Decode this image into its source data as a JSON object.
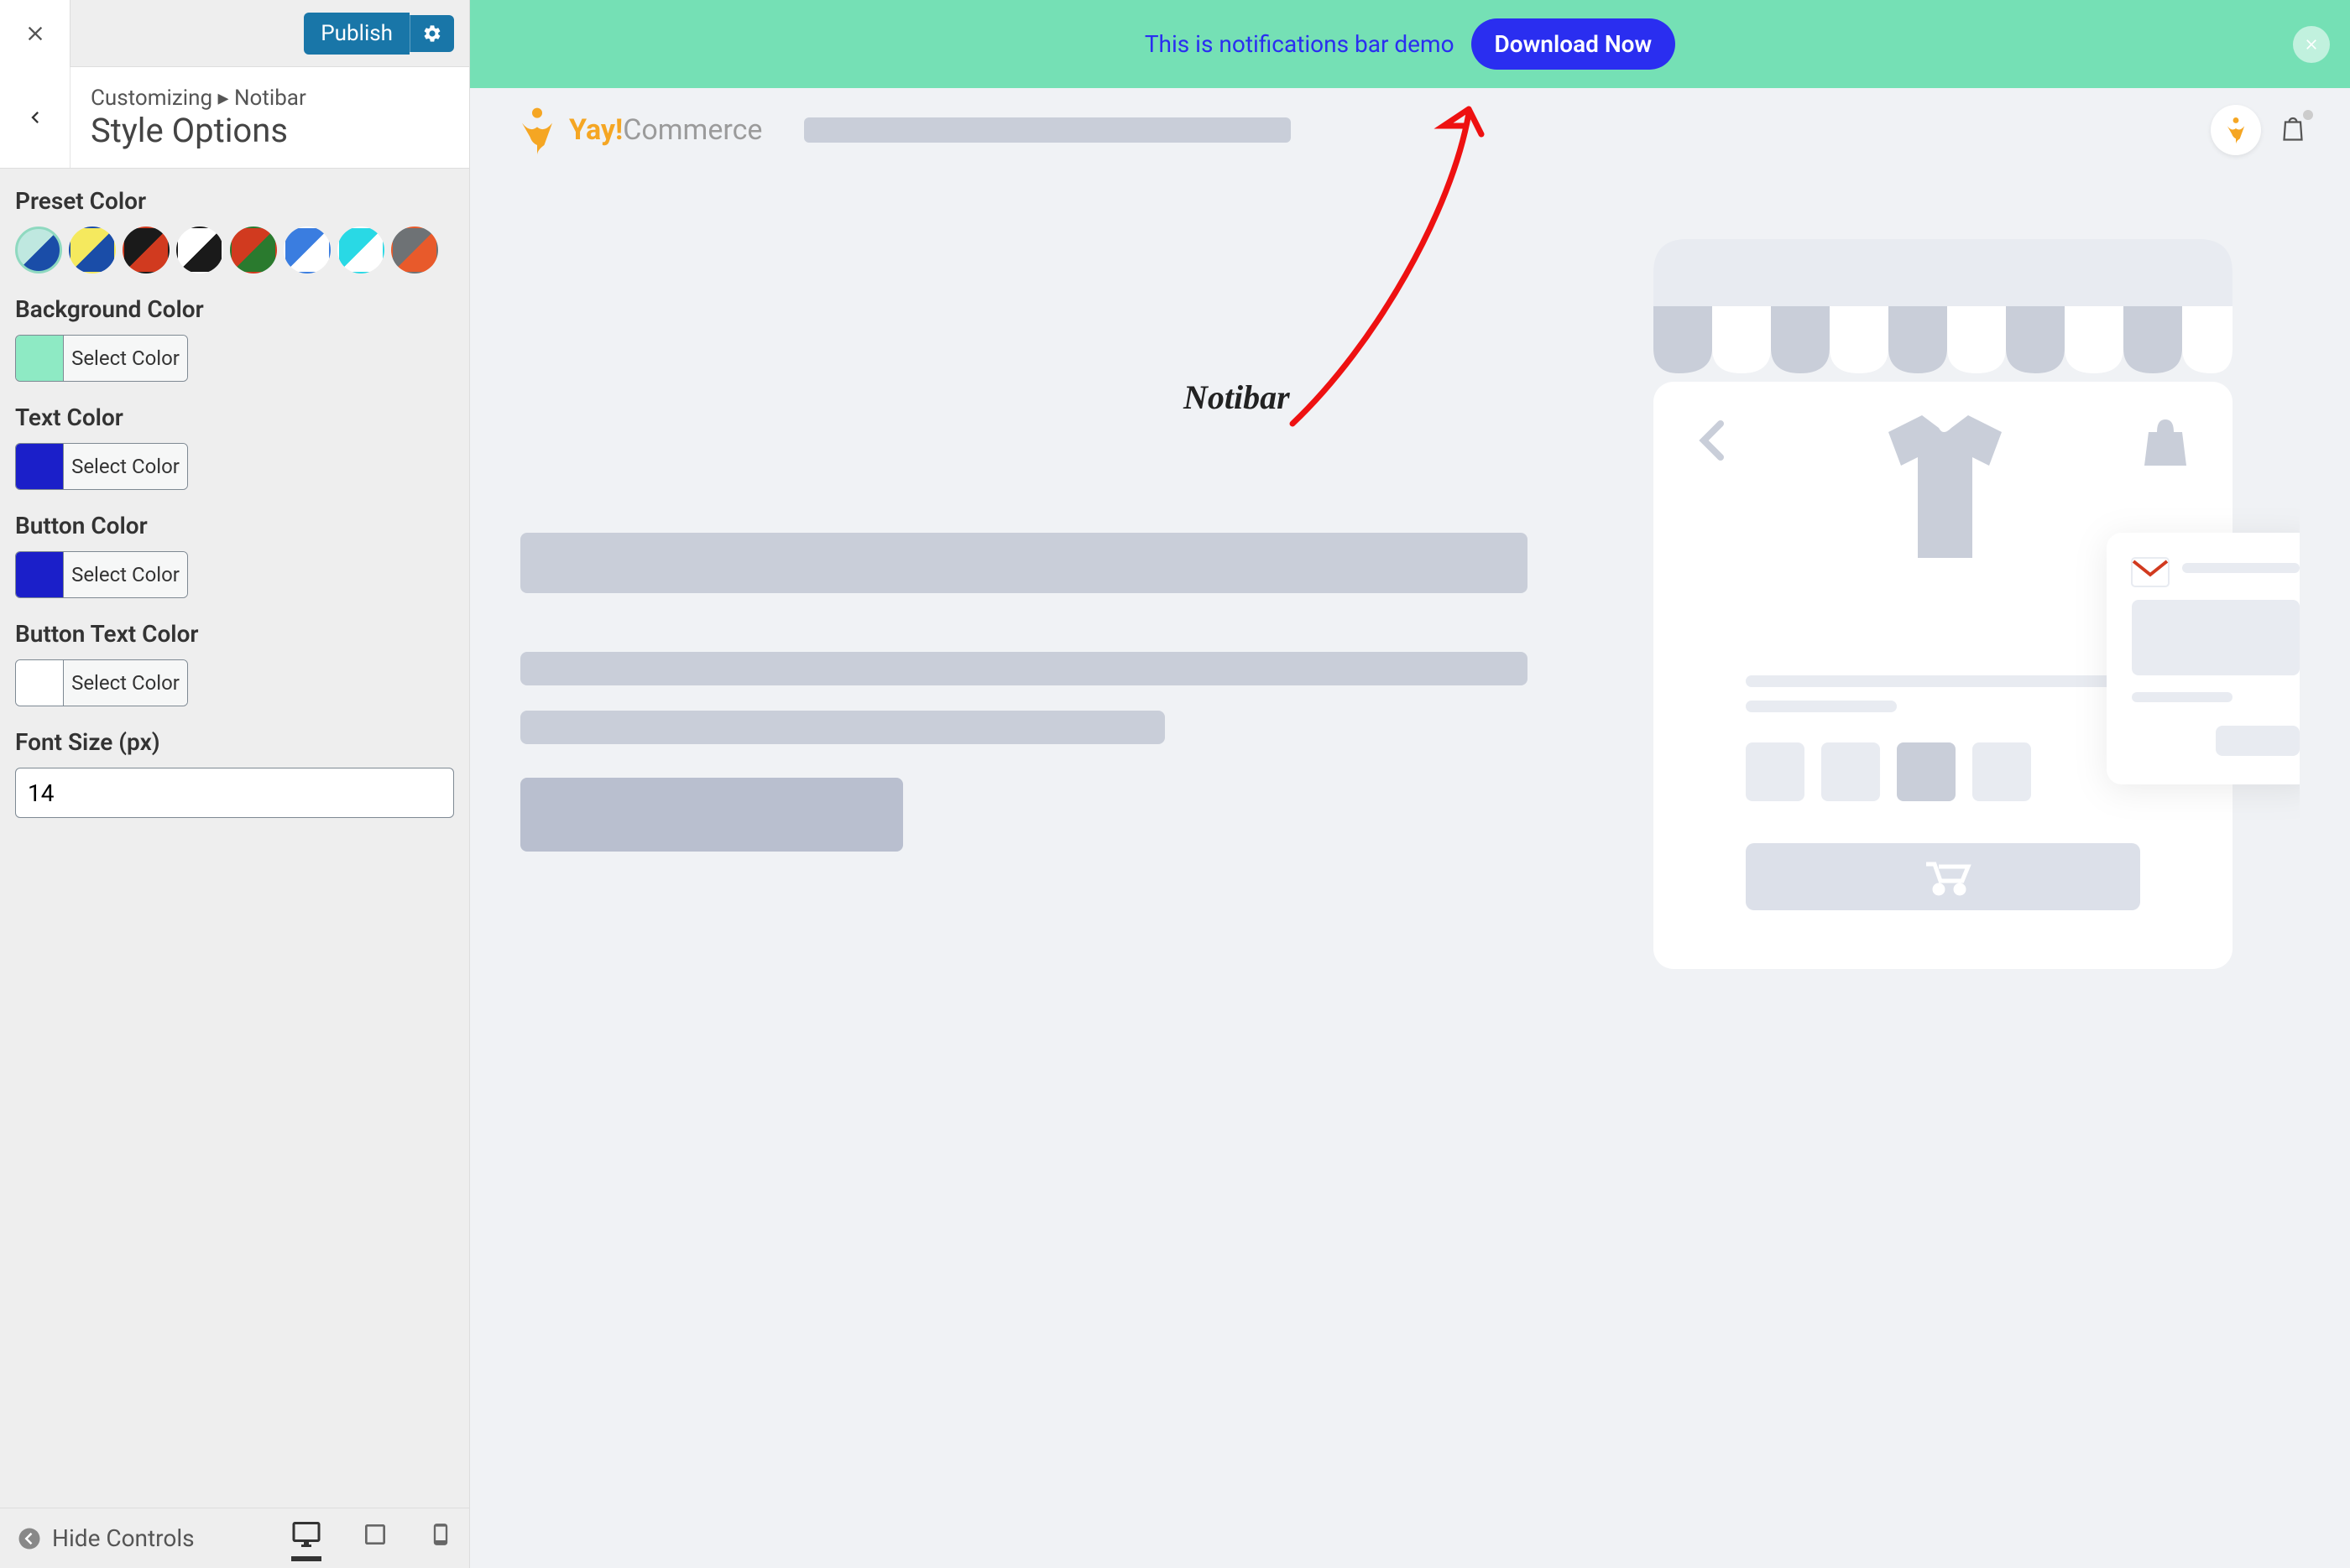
{
  "sidebar": {
    "publish_label": "Publish",
    "breadcrumb_prefix": "Customizing ▸ Notibar",
    "breadcrumb_title": "Style Options",
    "preset_color_label": "Preset Color",
    "background_color_label": "Background Color",
    "text_color_label": "Text Color",
    "button_color_label": "Button Color",
    "button_text_color_label": "Button Text Color",
    "font_size_label": "Font Size (px)",
    "select_color_label": "Select Color",
    "font_size_value": "14",
    "hide_controls_label": "Hide Controls",
    "background_color_value": "#8eeac4",
    "text_color_value": "#1b1fc9",
    "button_color_value": "#1b1fc9",
    "button_text_color_value": "#ffffff"
  },
  "preset_swatches": [
    {
      "css": "linear-gradient(135deg, #bfe8e0 50%, #1a4da8 50%)",
      "selected": true
    },
    {
      "css": "linear-gradient(135deg, #f5e95e 50%, #1a4da8 50%)"
    },
    {
      "css": "linear-gradient(135deg, #1a1a1a 50%, #d13a1f 50%)"
    },
    {
      "css": "linear-gradient(135deg, #ffffff 50%, #1a1a1a 50%)"
    },
    {
      "css": "linear-gradient(135deg, #d13a1f 50%, #2a7a2e 50%)"
    },
    {
      "css": "linear-gradient(135deg, #3a7de0 50%, #ffffff 50%)"
    },
    {
      "css": "linear-gradient(135deg, #29d9e5 50%, #ffffff 50%)"
    },
    {
      "css": "linear-gradient(135deg, #6e7275 50%, #e85a2b 50%)"
    }
  ],
  "notibar": {
    "text": "This is notifications bar demo",
    "button_label": "Download Now"
  },
  "logo": {
    "yay": "Yay!",
    "commerce": "Commerce"
  },
  "annotation": "Notibar"
}
